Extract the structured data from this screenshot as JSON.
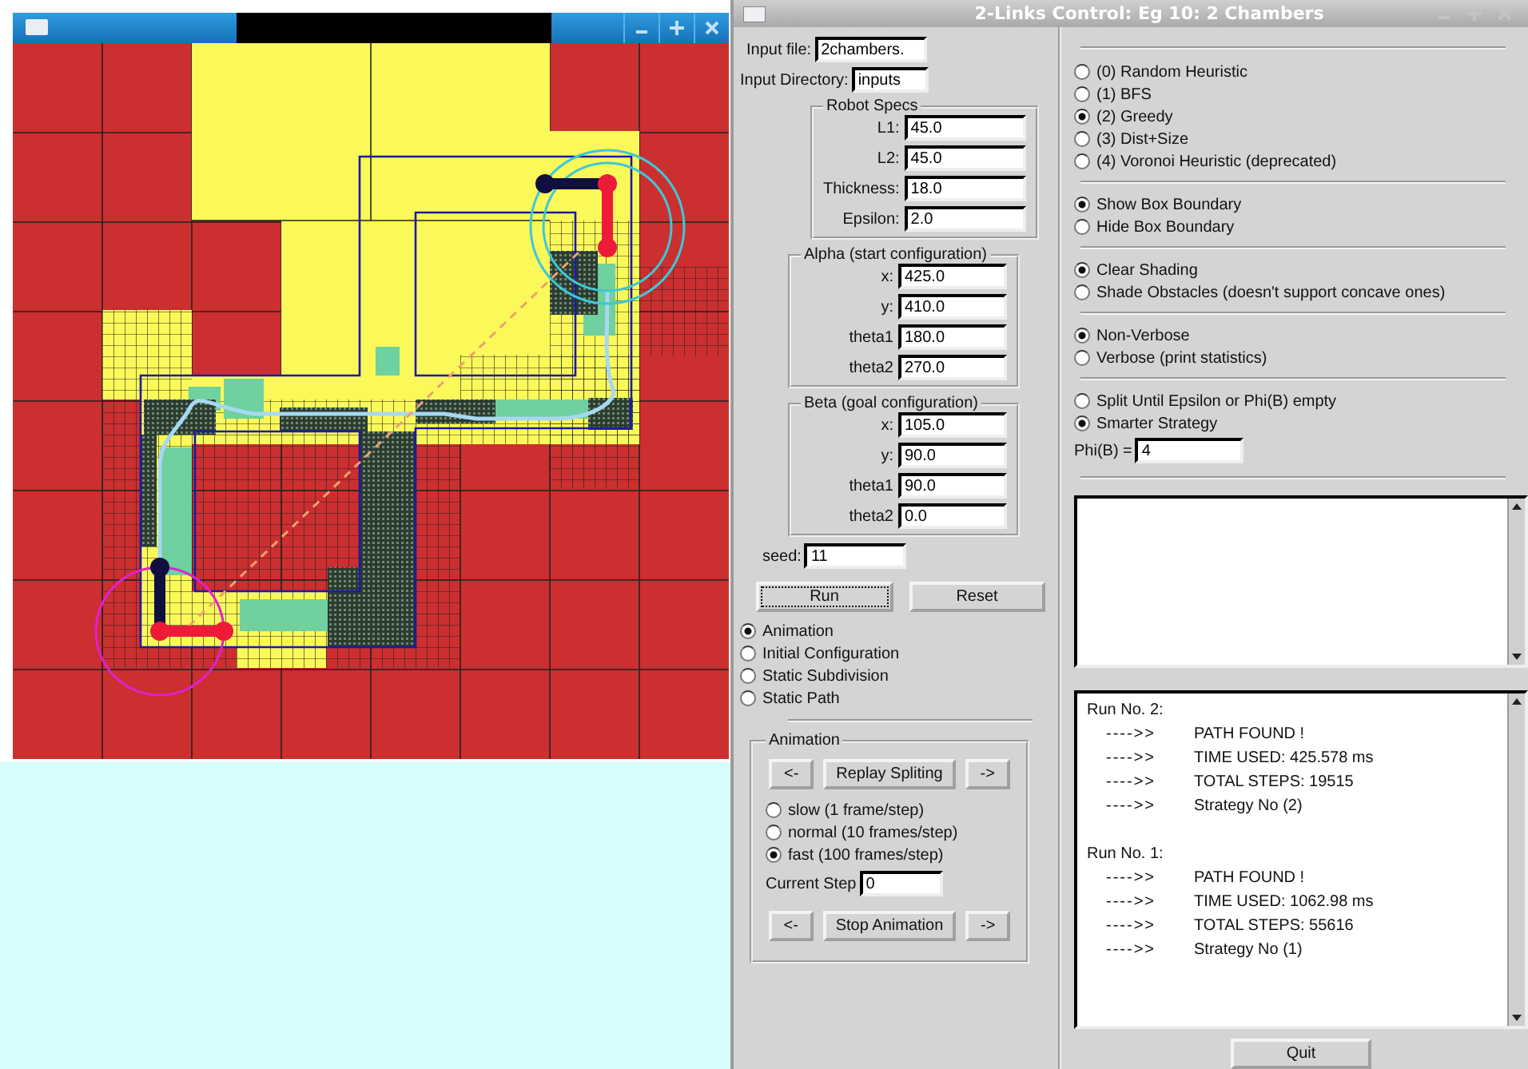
{
  "control_window": {
    "title": "2-Links Control: Eg 10: 2 Chambers"
  },
  "inputs": [
    {
      "label": "Input file:",
      "value": "2chambers."
    },
    {
      "label": "Input Directory:",
      "value": "inputs"
    }
  ],
  "groups": [
    {
      "title": "Robot Specs",
      "fields": [
        {
          "label": "L1:",
          "value": "45.0"
        },
        {
          "label": "L2:",
          "value": "45.0"
        },
        {
          "label": "Thickness:",
          "value": "18.0"
        },
        {
          "label": "Epsilon:",
          "value": "2.0"
        }
      ]
    },
    {
      "title": "Alpha (start configuration)",
      "fields": [
        {
          "label": "x:",
          "value": "425.0"
        },
        {
          "label": "y:",
          "value": "410.0"
        },
        {
          "label": "theta1",
          "value": "180.0"
        },
        {
          "label": "theta2",
          "value": "270.0"
        }
      ]
    },
    {
      "title": "Beta (goal configuration)",
      "fields": [
        {
          "label": "x:",
          "value": "105.0"
        },
        {
          "label": "y:",
          "value": "90.0"
        },
        {
          "label": "theta1",
          "value": "90.0"
        },
        {
          "label": "theta2",
          "value": "0.0"
        }
      ]
    }
  ],
  "seed": {
    "label": "seed:",
    "value": "11"
  },
  "buttons": [
    {
      "label": "Run",
      "focused": true
    },
    {
      "label": "Reset",
      "focused": false
    }
  ],
  "view_modes": [
    {
      "label": "Animation",
      "selected": true
    },
    {
      "label": "Initial Configuration",
      "selected": false
    },
    {
      "label": "Static Subdivision",
      "selected": false
    },
    {
      "label": "Static Path",
      "selected": false
    }
  ],
  "animation": {
    "title": "Animation",
    "replay_row": {
      "prev": "<-",
      "label": "Replay Spliting",
      "next": "->"
    },
    "speeds": [
      {
        "label": "slow (1 frame/step)",
        "selected": false
      },
      {
        "label": "normal (10 frames/step)",
        "selected": false
      },
      {
        "label": "fast (100 frames/step)",
        "selected": true
      }
    ],
    "current_step": {
      "label": "Current Step",
      "value": "0"
    },
    "stop_row": {
      "prev": "<-",
      "label": "Stop Animation",
      "next": "->"
    }
  },
  "option_groups": [
    {
      "options": [
        {
          "label": "(0) Random Heuristic",
          "selected": false
        },
        {
          "label": "(1) BFS",
          "selected": false
        },
        {
          "label": "(2) Greedy",
          "selected": true
        },
        {
          "label": "(3) Dist+Size",
          "selected": false
        },
        {
          "label": "(4) Voronoi Heuristic (deprecated)",
          "selected": false
        }
      ]
    },
    {
      "options": [
        {
          "label": "Show Box Boundary",
          "selected": true
        },
        {
          "label": "Hide Box Boundary",
          "selected": false
        }
      ]
    },
    {
      "options": [
        {
          "label": "Clear Shading",
          "selected": true
        },
        {
          "label": "Shade Obstacles (doesn't support concave ones)",
          "selected": false
        }
      ]
    },
    {
      "options": [
        {
          "label": "Non-Verbose",
          "selected": true
        },
        {
          "label": "Verbose (print statistics)",
          "selected": false
        }
      ]
    },
    {
      "options": [
        {
          "label": "Split Until Epsilon or Phi(B) empty",
          "selected": false
        },
        {
          "label": "Smarter Strategy",
          "selected": true
        }
      ],
      "field": {
        "label": "Phi(B) =",
        "value": "4"
      }
    }
  ],
  "runs": [
    {
      "heading": "Run No. 2:",
      "entries": [
        {
          "arrow": "---->>",
          "text": "PATH FOUND !"
        },
        {
          "arrow": "---->>",
          "text": "TIME USED: 425.578 ms"
        },
        {
          "arrow": "---->>",
          "text": "TOTAL STEPS: 19515"
        },
        {
          "arrow": "---->>",
          "text": "Strategy No (2)"
        }
      ]
    },
    {
      "heading": "Run No. 1:",
      "entries": [
        {
          "arrow": "---->>",
          "text": "PATH FOUND !"
        },
        {
          "arrow": "---->>",
          "text": "TIME USED: 1062.98 ms"
        },
        {
          "arrow": "---->>",
          "text": "TOTAL STEPS: 55616"
        },
        {
          "arrow": "---->>",
          "text": "Strategy No (1)"
        }
      ]
    }
  ],
  "quit_button": "Quit"
}
